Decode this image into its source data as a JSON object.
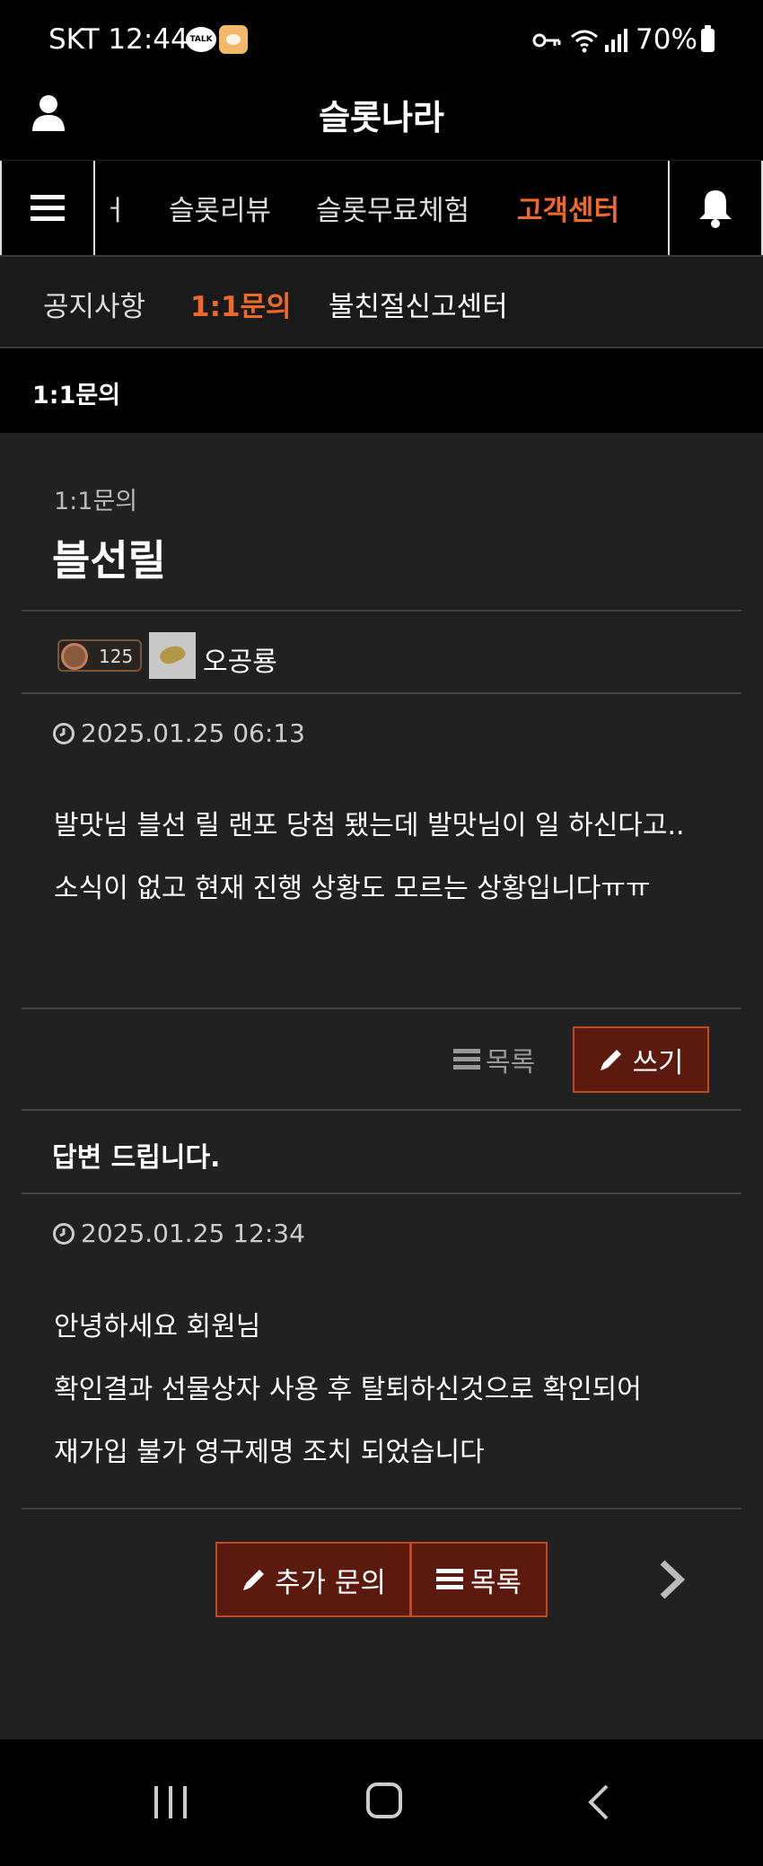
{
  "status_bar": {
    "carrier_time": "SKT 12:44",
    "talk_badge": "TALK",
    "battery": "70%"
  },
  "header": {
    "site_title": "슬롯나라"
  },
  "main_nav": {
    "items": [
      {
        "label": "ㅓ"
      },
      {
        "label": "슬롯리뷰"
      },
      {
        "label": "슬롯무료체험"
      },
      {
        "label": "고객센터"
      }
    ]
  },
  "sub_nav": {
    "items": [
      {
        "label": "공지사항"
      },
      {
        "label": "1:1문의"
      },
      {
        "label": "불친절신고센터"
      }
    ]
  },
  "section": {
    "title": "1:1문의"
  },
  "post": {
    "category": "1:1문의",
    "title": "블선릴",
    "level": "125",
    "author": "오공룡",
    "datetime": "2025.01.25 06:13",
    "body": [
      "발맛님 블선 릴 랜포 당첨 됐는데 발맛님이 일 하신다고..",
      "소식이 없고 현재 진행 상황도 모르는 상황입니다ㅠㅠ"
    ],
    "list_label": "목록",
    "write_label": "쓰기"
  },
  "answer": {
    "title": "답변 드립니다.",
    "datetime": "2025.01.25 12:34",
    "body": [
      "안녕하세요 회원님",
      "확인결과 선물상자 사용 후 탈퇴하신것으로 확인되어",
      "재가입 불가 영구제명 조치 되었습니다"
    ],
    "more_inquiry_label": "추가 문의",
    "list_label": "목록"
  },
  "colors": {
    "accent": "#ef6a2a",
    "button_bg": "#5c1a0f",
    "button_border": "#c04a1e",
    "content_bg": "#212121"
  }
}
